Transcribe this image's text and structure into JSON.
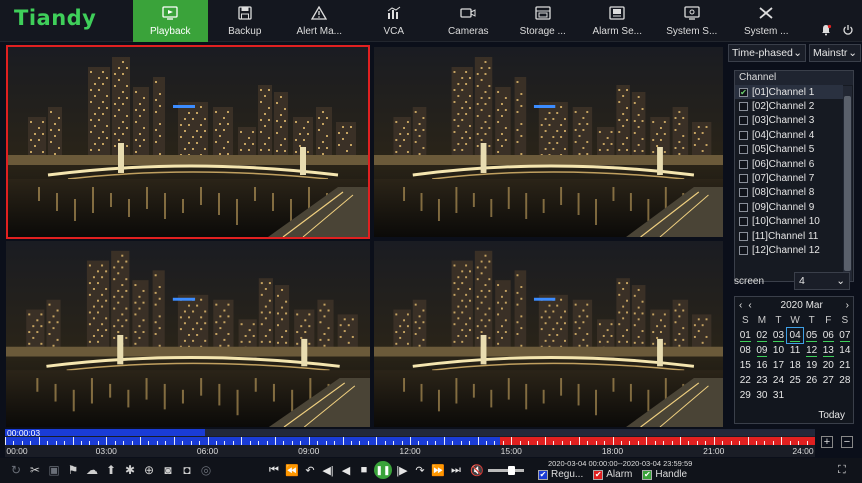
{
  "app": {
    "logo": "Tiandy"
  },
  "nav": [
    {
      "label": "Playback",
      "icon": "playback-icon",
      "active": true
    },
    {
      "label": "Backup",
      "icon": "save-icon"
    },
    {
      "label": "Alert Ma...",
      "icon": "alert-icon"
    },
    {
      "label": "VCA",
      "icon": "vca-icon"
    },
    {
      "label": "Cameras",
      "icon": "camera-icon"
    },
    {
      "label": "Storage ...",
      "icon": "storage-icon"
    },
    {
      "label": "Alarm Se...",
      "icon": "alarm-icon"
    },
    {
      "label": "System S...",
      "icon": "system-settings-icon"
    },
    {
      "label": "System ...",
      "icon": "tools-icon"
    }
  ],
  "panel": {
    "mode": "Time-phased",
    "stream": "Mainstr",
    "channel_header": "Channel",
    "channels": [
      {
        "label": "[01]Channel 1",
        "checked": true
      },
      {
        "label": "[02]Channel 2",
        "checked": false
      },
      {
        "label": "[03]Channel 3",
        "checked": false
      },
      {
        "label": "[04]Channel 4",
        "checked": false
      },
      {
        "label": "[05]Channel 5",
        "checked": false
      },
      {
        "label": "[06]Channel 6",
        "checked": false
      },
      {
        "label": "[07]Channel 7",
        "checked": false
      },
      {
        "label": "[08]Channel 8",
        "checked": false
      },
      {
        "label": "[09]Channel 9",
        "checked": false
      },
      {
        "label": "[10]Channel 10",
        "checked": false
      },
      {
        "label": "[11]Channel 11",
        "checked": false
      },
      {
        "label": "[12]Channel 12",
        "checked": false
      }
    ],
    "screen_label": "screen",
    "screen_value": "4",
    "calendar": {
      "title": "2020 Mar",
      "dow": [
        "S",
        "M",
        "T",
        "W",
        "T",
        "F",
        "S"
      ],
      "days": [
        [
          "01",
          "02",
          "03",
          "04",
          "05",
          "06",
          "07"
        ],
        [
          "08",
          "09",
          "10",
          "11",
          "12",
          "13",
          "14"
        ],
        [
          "15",
          "16",
          "17",
          "18",
          "19",
          "20",
          "21"
        ],
        [
          "22",
          "23",
          "24",
          "25",
          "26",
          "27",
          "28"
        ],
        [
          "29",
          "30",
          "31",
          "",
          "",
          "",
          ""
        ]
      ],
      "recorded": [
        "01",
        "02",
        "03",
        "04",
        "05",
        "06",
        "07",
        "09",
        "12",
        "13"
      ],
      "selected": "04",
      "today_label": "Today"
    }
  },
  "timeline": {
    "current": "00:00:03",
    "labels": [
      "00:00",
      "03:00",
      "06:00",
      "09:00",
      "12:00",
      "15:00",
      "18:00",
      "21:00",
      "24:00"
    ]
  },
  "bottom": {
    "time_range": "2020-03-04 00:00:00--2020-03-04 23:59:59",
    "legend": [
      {
        "label": "Regu...",
        "color": "#1a3cd6"
      },
      {
        "label": "Alarm",
        "color": "#e02020"
      },
      {
        "label": "Handle",
        "color": "#3aa33a"
      }
    ]
  }
}
